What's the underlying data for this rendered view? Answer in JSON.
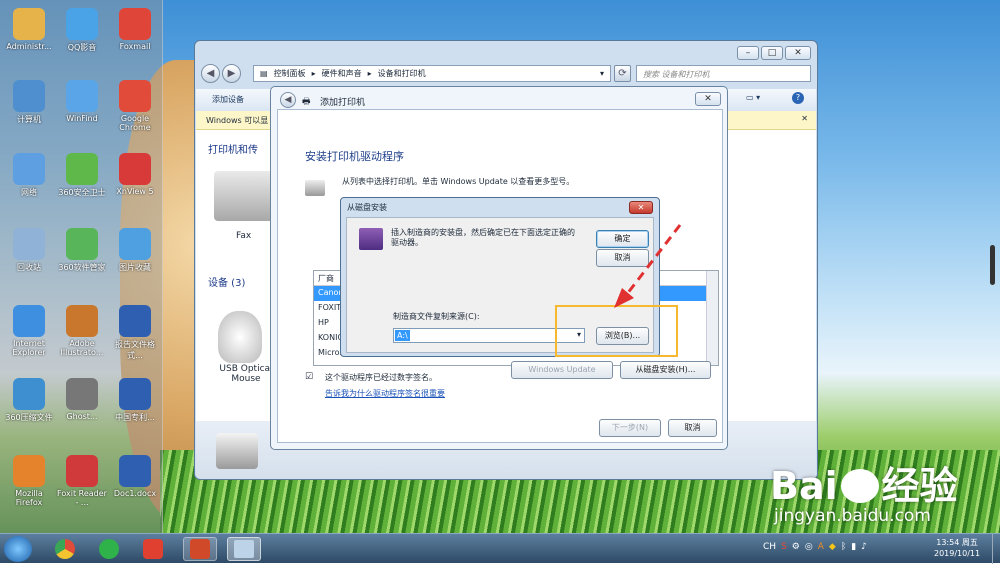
{
  "desktop_icons": [
    {
      "label": "Administr...",
      "color": "#e6b34a"
    },
    {
      "label": "QQ影音",
      "color": "#4aa3e6"
    },
    {
      "label": "Foxmail",
      "color": "#e0453a"
    },
    {
      "label": "计算机",
      "color": "#4f8fd0"
    },
    {
      "label": "WinFind",
      "color": "#5aa5e8"
    },
    {
      "label": "Google Chrome",
      "color": "#e04b3a"
    },
    {
      "label": "网络",
      "color": "#5d9fe0"
    },
    {
      "label": "360安全卫士",
      "color": "#5fb84a"
    },
    {
      "label": "XnView 5",
      "color": "#d83a3a"
    },
    {
      "label": "回收站",
      "color": "#8fb2d6"
    },
    {
      "label": "360软件管家",
      "color": "#59b55a"
    },
    {
      "label": "图片收藏",
      "color": "#4fa0e0"
    },
    {
      "label": "Internet Explorer",
      "color": "#3e8fe0"
    },
    {
      "label": "Adobe Illustrato...",
      "color": "#c9772c"
    },
    {
      "label": "报告文件格式...",
      "color": "#2f5fb0"
    },
    {
      "label": "360压缩文件",
      "color": "#3e8fd0"
    },
    {
      "label": "Ghost...",
      "color": "#777"
    },
    {
      "label": "中国专利...",
      "color": "#2f5fb0"
    },
    {
      "label": "Mozilla Firefox",
      "color": "#e5822c"
    },
    {
      "label": "Foxit Reader - ...",
      "color": "#d03a3a"
    },
    {
      "label": "Doc1.docx",
      "color": "#2f5fb0"
    }
  ],
  "explorer": {
    "breadcrumb": [
      "控制面板",
      "硬件和声音",
      "设备和打印机"
    ],
    "search_placeholder": "搜索 设备和打印机",
    "toolbar_add": "添加设备",
    "infobar": "Windows 可以显",
    "section_printers": "打印机和传",
    "printer_fax": "Fax",
    "section_devices": "设备 (3)",
    "device_mouse": "USB Optical Mouse"
  },
  "add_printer": {
    "title": "添加打印机",
    "heading": "安装打印机驱动程序",
    "desc": "从列表中选择打印机。单击 Windows Update 以查看更多型号。",
    "list_header": "厂商",
    "vendors": [
      "Canon",
      "FOXIT",
      "HP",
      "KONIC",
      "Micros"
    ],
    "signed_note": "这个驱动程序已经过数字签名。",
    "why_link": "告诉我为什么驱动程序签名很重要",
    "windows_update": "Windows Update",
    "have_disk": "从磁盘安装(H)...",
    "next": "下一步(N)",
    "cancel": "取消"
  },
  "install_from_disk": {
    "title": "从磁盘安装",
    "message": "插入制造商的安装盘，然后确定已在下面选定正确的驱动器。",
    "ok": "确定",
    "cancel": "取消",
    "copy_from_label": "制造商文件复制来源(C):",
    "copy_from_value": "A:\\",
    "browse": "浏览(B)..."
  },
  "clock": {
    "time": "13:54 周五",
    "date": "2019/10/11"
  },
  "watermark": {
    "brand": "Bai",
    "brand2": "经验",
    "url": "jingyan.baidu.com"
  },
  "colors": {
    "highlight": "#f5b82e",
    "arrow": "#e03030",
    "selected": "#3399ff"
  }
}
